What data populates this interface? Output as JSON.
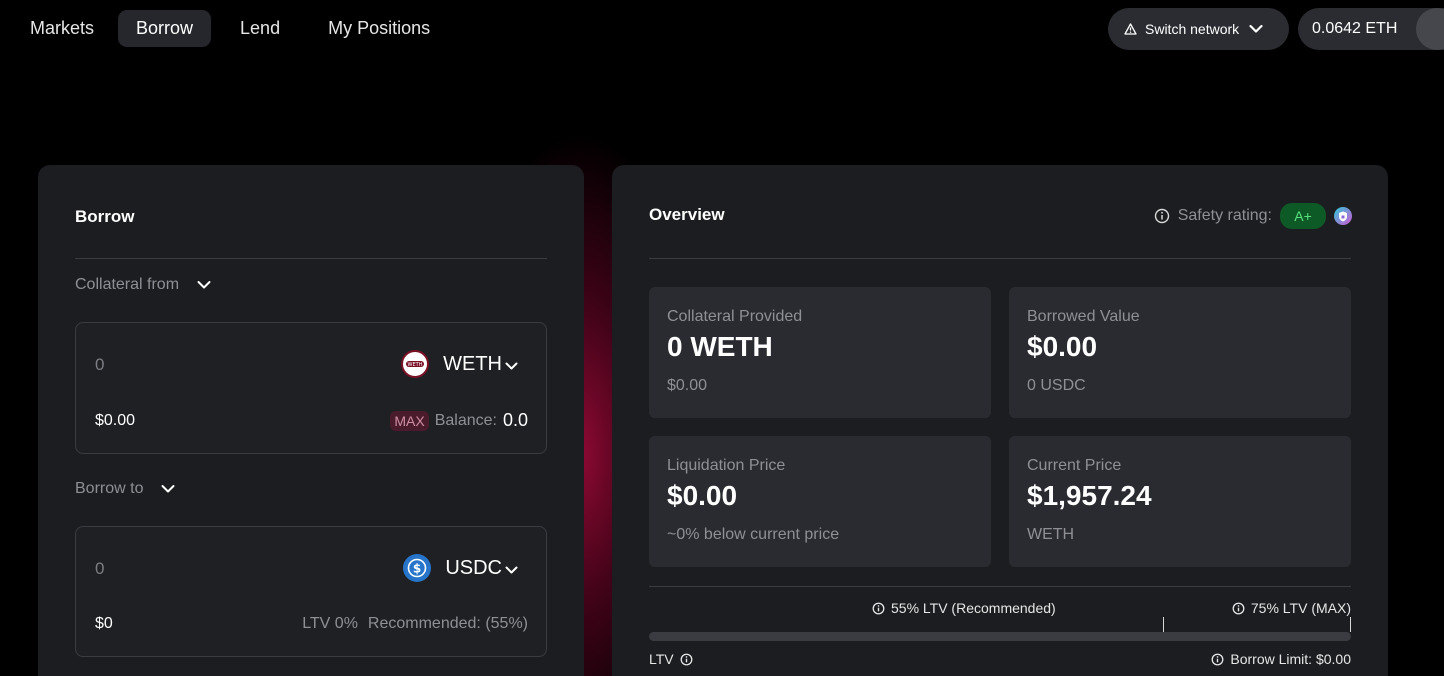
{
  "nav": {
    "items": [
      {
        "label": "Markets"
      },
      {
        "label": "Borrow"
      },
      {
        "label": "Lend"
      },
      {
        "label": "My Positions"
      }
    ],
    "switch_network": "Switch network",
    "wallet_balance": "0.0642 ETH"
  },
  "borrow": {
    "title": "Borrow",
    "collateral_label": "Collateral from",
    "collateral_amount": "0",
    "collateral_token": "WETH",
    "collateral_usd": "$0.00",
    "max_label": "MAX",
    "balance_label": "Balance:",
    "balance_value": "0.0",
    "borrow_to_label": "Borrow to",
    "borrow_amount": "0",
    "borrow_token": "USDC",
    "borrow_usd": "$0",
    "ltv_text": "LTV 0%",
    "recommended_text": "Recommended: (55%)"
  },
  "overview": {
    "title": "Overview",
    "safety_label": "Safety rating:",
    "safety_grade": "A+",
    "cards": [
      {
        "label": "Collateral Provided",
        "value": "0 WETH",
        "sub": "$0.00"
      },
      {
        "label": "Borrowed Value",
        "value": "$0.00",
        "sub": "0 USDC"
      },
      {
        "label": "Liquidation Price",
        "value": "$0.00",
        "sub": "~0% below current price"
      },
      {
        "label": "Current Price",
        "value": "$1,957.24",
        "sub": "WETH"
      }
    ],
    "ltv_recommended": "55% LTV (Recommended)",
    "ltv_max": "75% LTV (MAX)",
    "ltv_label": "LTV",
    "borrow_limit": "Borrow Limit: $0.00",
    "ltv_current": 0
  },
  "colors": {
    "background": "#000000",
    "panel": "#1c1d21",
    "card": "#2a2b30",
    "accent_glow": "#960a37",
    "grade_green": "#58e07e"
  }
}
